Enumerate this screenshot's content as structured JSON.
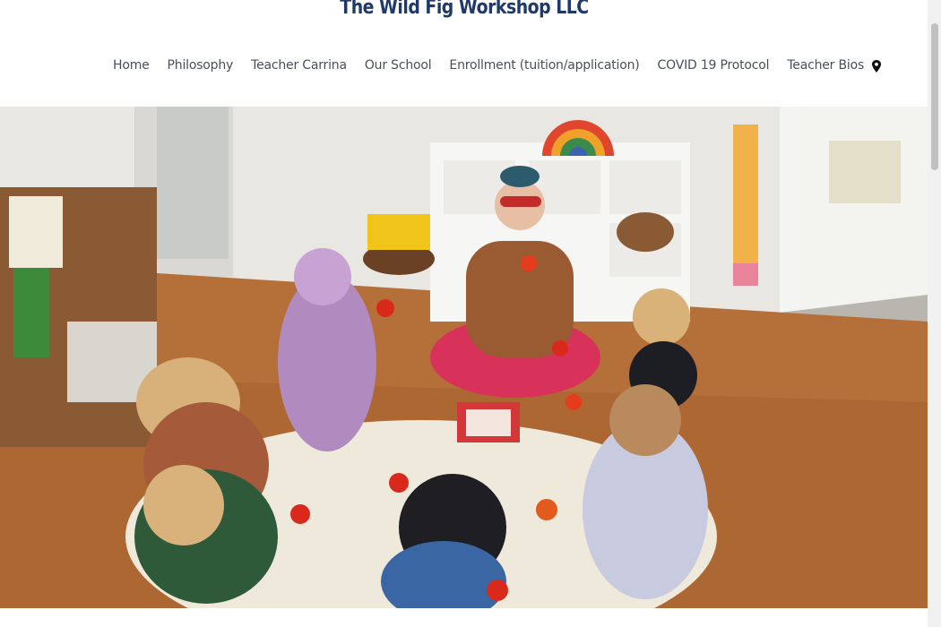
{
  "header": {
    "site_title": "The Wild Fig Workshop LLC"
  },
  "nav": {
    "items": [
      {
        "label": "Home"
      },
      {
        "label": "Philosophy"
      },
      {
        "label": "Teacher Carrina"
      },
      {
        "label": "Our School"
      },
      {
        "label": "Enrollment (tuition/application)"
      },
      {
        "label": "COVID 19 Protocol"
      },
      {
        "label": "Teacher Bios"
      }
    ],
    "location_icon": "map-pin-icon"
  },
  "hero": {
    "image_subject": "teacher and children sitting in a circle on a classroom floor"
  },
  "colors": {
    "title": "#1f3a68",
    "nav_text": "#4a4f57",
    "floor": "#b56f38"
  }
}
